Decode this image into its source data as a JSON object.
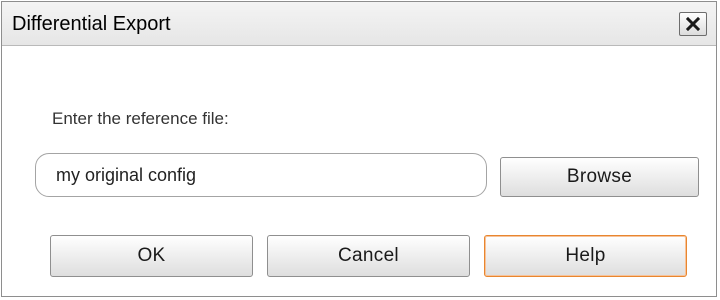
{
  "window": {
    "title": "Differential Export",
    "close_icon": "close-icon"
  },
  "form": {
    "reference_label": "Enter the reference file:",
    "reference_value": "my original config",
    "browse_label": "Browse"
  },
  "actions": {
    "ok_label": "OK",
    "cancel_label": "Cancel",
    "help_label": "Help"
  },
  "colors": {
    "focus_accent": "#e8862f"
  }
}
